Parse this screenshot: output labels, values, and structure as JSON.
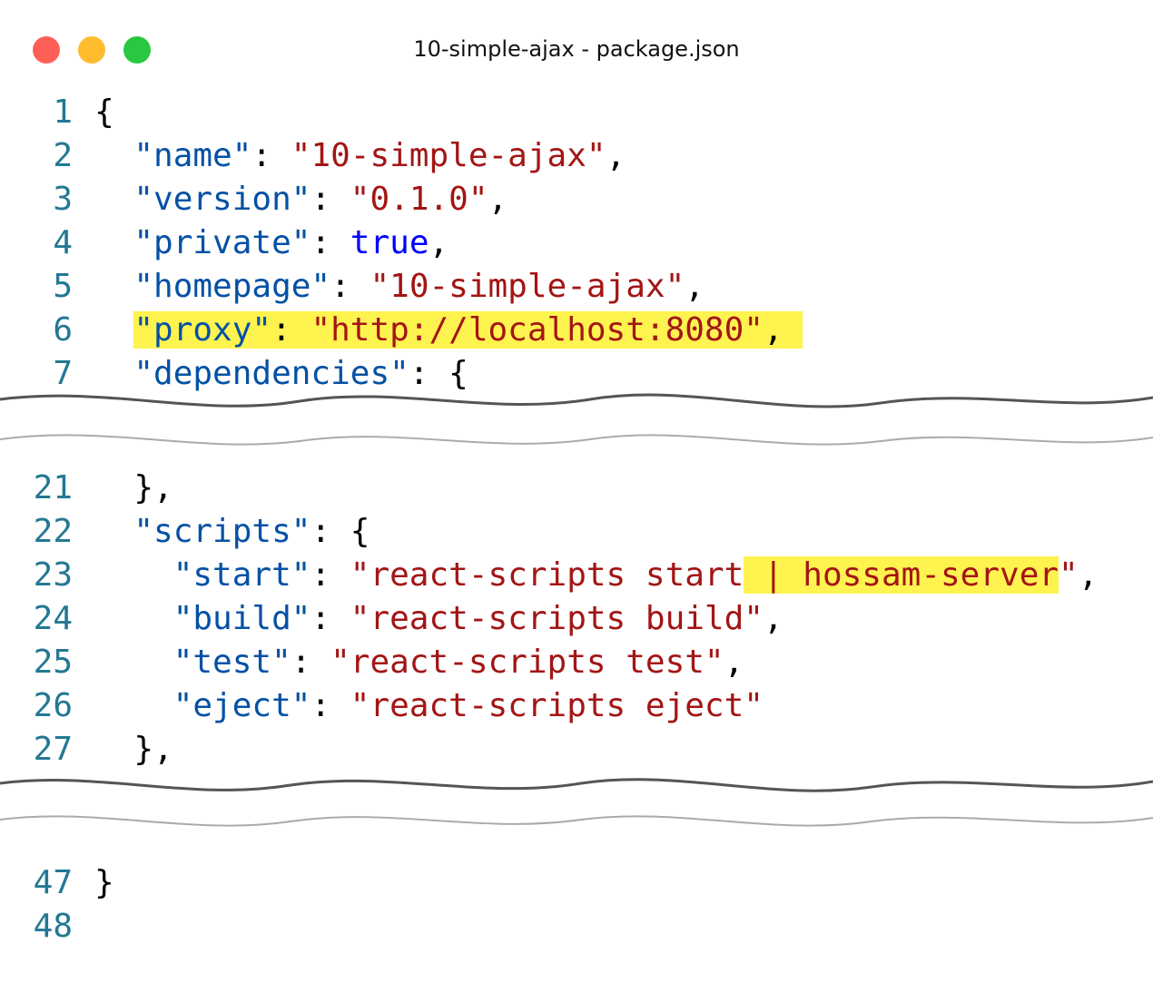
{
  "window": {
    "title": "10-simple-ajax - package.json"
  },
  "colors": {
    "key": "#0451a5",
    "string": "#a31515",
    "boolean": "#0000ff",
    "highlight": "#fff34f",
    "line_number": "#237893"
  },
  "section1": [
    {
      "n": "1",
      "indent": "",
      "tokens": [
        [
          "p",
          "{"
        ]
      ]
    },
    {
      "n": "2",
      "indent": "  ",
      "tokens": [
        [
          "k",
          "\"name\""
        ],
        [
          "p",
          ": "
        ],
        [
          "s",
          "\"10-simple-ajax\""
        ],
        [
          "p",
          ","
        ]
      ]
    },
    {
      "n": "3",
      "indent": "  ",
      "tokens": [
        [
          "k",
          "\"version\""
        ],
        [
          "p",
          ": "
        ],
        [
          "s",
          "\"0.1.0\""
        ],
        [
          "p",
          ","
        ]
      ]
    },
    {
      "n": "4",
      "indent": "  ",
      "tokens": [
        [
          "k",
          "\"private\""
        ],
        [
          "p",
          ": "
        ],
        [
          "b",
          "true"
        ],
        [
          "p",
          ","
        ]
      ]
    },
    {
      "n": "5",
      "indent": "  ",
      "tokens": [
        [
          "k",
          "\"homepage\""
        ],
        [
          "p",
          ": "
        ],
        [
          "s",
          "\"10-simple-ajax\""
        ],
        [
          "p",
          ","
        ]
      ]
    },
    {
      "n": "6",
      "indent": "  ",
      "tokens": [
        [
          "k",
          "\"proxy\"",
          "hl"
        ],
        [
          "p",
          ": ",
          "hl"
        ],
        [
          "s",
          "\"http://localhost:8080\"",
          "hl"
        ],
        [
          "p",
          ", ",
          "hl"
        ]
      ]
    },
    {
      "n": "7",
      "indent": "  ",
      "tokens": [
        [
          "k",
          "\"dependencies\""
        ],
        [
          "p",
          ": {"
        ]
      ]
    }
  ],
  "section2": [
    {
      "n": "21",
      "indent": "  ",
      "tokens": [
        [
          "p",
          "},"
        ]
      ]
    },
    {
      "n": "22",
      "indent": "  ",
      "tokens": [
        [
          "k",
          "\"scripts\""
        ],
        [
          "p",
          ": {"
        ]
      ]
    },
    {
      "n": "23",
      "indent": "    ",
      "tokens": [
        [
          "k",
          "\"start\""
        ],
        [
          "p",
          ": "
        ],
        [
          "s",
          "\"react-scripts start"
        ],
        [
          "s",
          " | hossam-server",
          "hl"
        ],
        [
          "s",
          "\""
        ],
        [
          "p",
          ","
        ]
      ]
    },
    {
      "n": "24",
      "indent": "    ",
      "tokens": [
        [
          "k",
          "\"build\""
        ],
        [
          "p",
          ": "
        ],
        [
          "s",
          "\"react-scripts build\""
        ],
        [
          "p",
          ","
        ]
      ]
    },
    {
      "n": "25",
      "indent": "    ",
      "tokens": [
        [
          "k",
          "\"test\""
        ],
        [
          "p",
          ": "
        ],
        [
          "s",
          "\"react-scripts test\""
        ],
        [
          "p",
          ","
        ]
      ]
    },
    {
      "n": "26",
      "indent": "    ",
      "tokens": [
        [
          "k",
          "\"eject\""
        ],
        [
          "p",
          ": "
        ],
        [
          "s",
          "\"react-scripts eject\""
        ]
      ]
    },
    {
      "n": "27",
      "indent": "  ",
      "tokens": [
        [
          "p",
          "},"
        ]
      ]
    }
  ],
  "section3": [
    {
      "n": "47",
      "indent": "",
      "tokens": [
        [
          "p",
          "}"
        ]
      ]
    },
    {
      "n": "48",
      "indent": "",
      "tokens": []
    }
  ]
}
